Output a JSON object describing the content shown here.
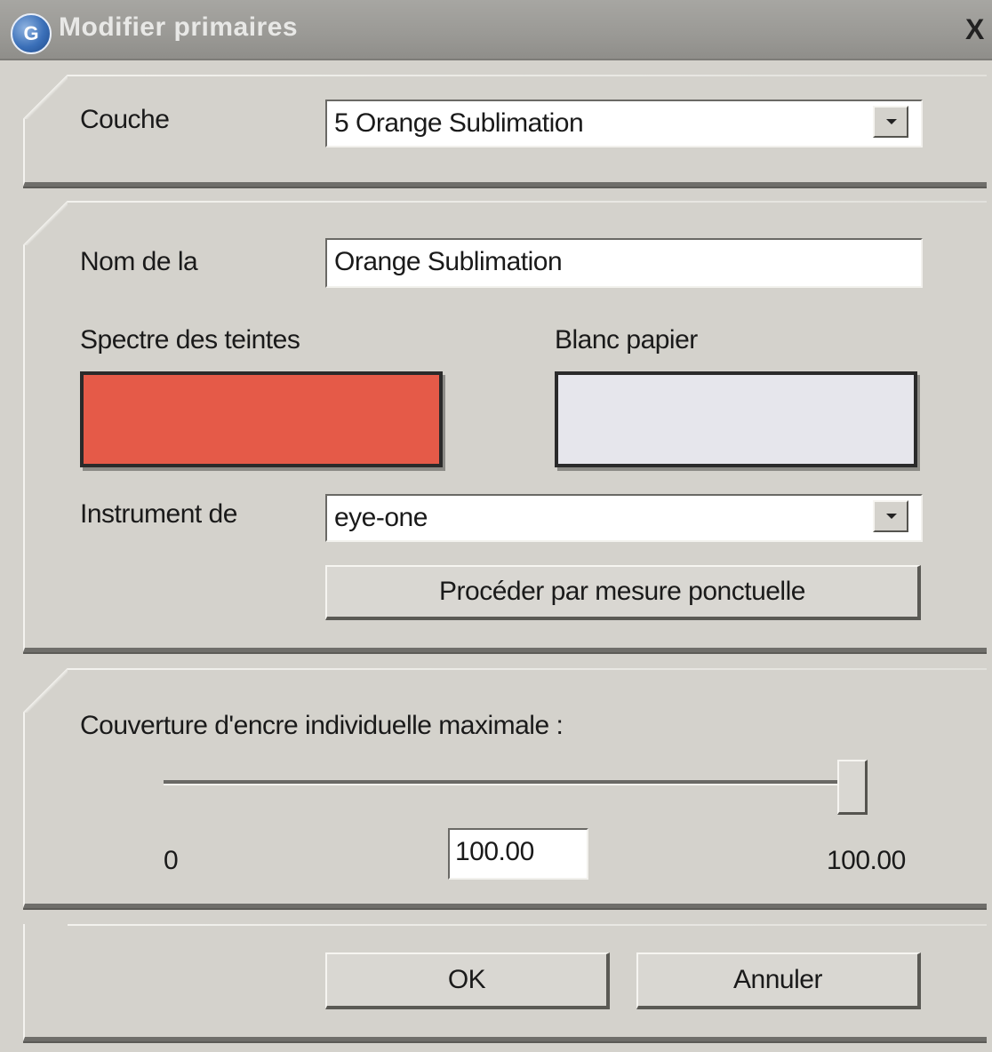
{
  "window": {
    "title": "Modifier primaires",
    "close_label": "X",
    "icon_name": "app-logo-icon"
  },
  "layer": {
    "label": "Couche",
    "selected": "5  Orange Sublimation"
  },
  "ink": {
    "name_label": "Nom de la",
    "name_value": "Orange Sublimation",
    "spectrum_label": "Spectre des teintes",
    "paper_label": "Blanc papier",
    "spectrum_color": "#e55a48",
    "paper_color": "#e6e6ec",
    "instrument_label": "Instrument de",
    "instrument_value": "eye-one",
    "measure_button": "Procéder par mesure ponctuelle"
  },
  "coverage": {
    "label": "Couverture d'encre individuelle maximale :",
    "min_label": "0",
    "max_label": "100.00",
    "value": "100.00",
    "slider_fraction": 1.0
  },
  "footer": {
    "ok_label": "OK",
    "cancel_label": "Annuler"
  }
}
